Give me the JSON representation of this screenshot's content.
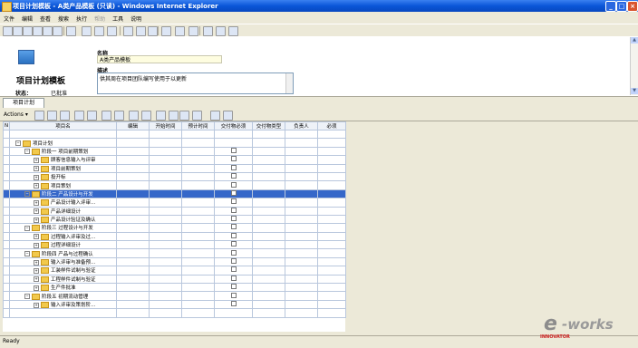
{
  "window": {
    "title": "项目计划模板 - A类产品模板 (只读) - Windows Internet Explorer"
  },
  "menu": [
    "文件",
    "编辑",
    "查看",
    "搜索",
    "执行",
    "帮助",
    "工具",
    "说明"
  ],
  "menu_disabled": [
    false,
    false,
    false,
    false,
    false,
    true,
    false,
    false
  ],
  "form": {
    "doc_title": "项目计划模板",
    "status_label": "状态：",
    "status_value": "已批准",
    "name_label": "名称",
    "name_value": "A类产品模板",
    "desc_label": "描述",
    "desc_value": "供其周在项目团队编写使用于以更新"
  },
  "tab": "项目计划",
  "actions_label": "Actions ▾",
  "grid": {
    "headers": [
      "N",
      "项目名",
      "编辑",
      "开始时间",
      "预计时间",
      "交付物必须",
      "交付物类型",
      "负责人",
      "必须"
    ],
    "rows": [
      {
        "indent": 0,
        "label": "项目计划",
        "pm": "−",
        "chk": false,
        "sel": false
      },
      {
        "indent": 1,
        "label": "阶段一 项目前期策划",
        "pm": "−",
        "chk": true,
        "sel": false
      },
      {
        "indent": 2,
        "label": "顾客信息输入与评审",
        "pm": "+",
        "chk": true,
        "sel": false
      },
      {
        "indent": 2,
        "label": "项目前期策划",
        "pm": "+",
        "chk": true,
        "sel": false
      },
      {
        "indent": 2,
        "label": "投开标",
        "pm": "+",
        "chk": true,
        "sel": false
      },
      {
        "indent": 2,
        "label": "项目策划",
        "pm": "+",
        "chk": true,
        "sel": false
      },
      {
        "indent": 1,
        "label": "阶段二 产品设计与开发",
        "pm": "−",
        "chk": true,
        "sel": true
      },
      {
        "indent": 2,
        "label": "产品设计输入评审...",
        "pm": "+",
        "chk": true,
        "sel": false
      },
      {
        "indent": 2,
        "label": "产品详细设计",
        "pm": "+",
        "chk": true,
        "sel": false
      },
      {
        "indent": 2,
        "label": "产品设计验证及确认",
        "pm": "+",
        "chk": true,
        "sel": false
      },
      {
        "indent": 1,
        "label": "阶段三 过程设计与开发",
        "pm": "−",
        "chk": true,
        "sel": false
      },
      {
        "indent": 2,
        "label": "过程输入评审及过...",
        "pm": "+",
        "chk": true,
        "sel": false
      },
      {
        "indent": 2,
        "label": "过程详细设计",
        "pm": "+",
        "chk": true,
        "sel": false
      },
      {
        "indent": 1,
        "label": "阶段四 产品与过程确认",
        "pm": "−",
        "chk": true,
        "sel": false
      },
      {
        "indent": 2,
        "label": "输入评审与准备预...",
        "pm": "+",
        "chk": true,
        "sel": false
      },
      {
        "indent": 2,
        "label": "工装样件试制与验证",
        "pm": "+",
        "chk": true,
        "sel": false
      },
      {
        "indent": 2,
        "label": "工程样件试制与验证",
        "pm": "+",
        "chk": true,
        "sel": false
      },
      {
        "indent": 2,
        "label": "生产件批准",
        "pm": "+",
        "chk": true,
        "sel": false
      },
      {
        "indent": 1,
        "label": "阶段五 初期流动管理",
        "pm": "−",
        "chk": true,
        "sel": false
      },
      {
        "indent": 2,
        "label": "输入评审及策划阶...",
        "pm": "+",
        "chk": true,
        "sel": false
      }
    ]
  },
  "statusbar": {
    "text": "Ready"
  },
  "logo": {
    "e": "e",
    "works": "-works",
    "tag": "INNOVATOR"
  }
}
